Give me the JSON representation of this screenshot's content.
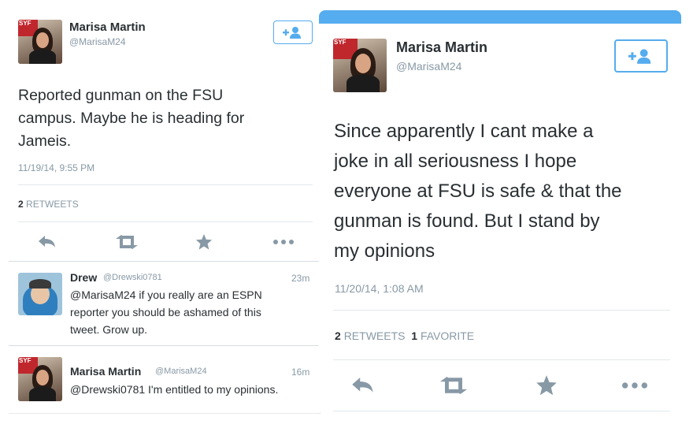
{
  "left": {
    "author": {
      "name": "Marisa Martin",
      "handle": "@MarisaM24",
      "avatar_sign": "SYF"
    },
    "tweet": {
      "text_lines": [
        "Reported gunman on the FSU",
        "campus. Maybe he is heading for",
        "Jameis."
      ],
      "timestamp": "11/19/14, 9:55 PM",
      "retweet_count": "2",
      "retweets_label": "RETWEETS"
    },
    "replies": [
      {
        "name": "Drew",
        "handle": "@Drewski0781",
        "time": "23m",
        "text_lines": [
          "@MarisaM24 if you really are an ESPN",
          "reporter you should be ashamed of this",
          "tweet. Grow up."
        ]
      },
      {
        "name": "Marisa Martin",
        "handle": "@MarisaM24",
        "time": "16m",
        "text_lines": [
          "@Drewski0781 I'm entitled to my opinions."
        ]
      }
    ]
  },
  "right": {
    "author": {
      "name": "Marisa Martin",
      "handle": "@MarisaM24",
      "avatar_sign": "SYF"
    },
    "tweet": {
      "text_lines": [
        "Since apparently I cant make a",
        "joke in all seriousness I hope",
        "everyone at FSU is safe & that the",
        "gunman is found. But I stand by",
        "my opinions"
      ],
      "timestamp": "11/20/14, 1:08 AM",
      "retweet_count": "2",
      "retweets_label": "RETWEETS",
      "favorite_count": "1",
      "favorite_label": "FAVORITE"
    }
  },
  "icons": {
    "follow": "add-user-icon",
    "reply": "reply-icon",
    "retweet": "retweet-icon",
    "favorite": "star-icon",
    "more": "more-icon"
  },
  "colors": {
    "brand_blue": "#55acee",
    "text": "#292f33",
    "muted": "#8899a6",
    "divider": "#e1e8ed"
  }
}
